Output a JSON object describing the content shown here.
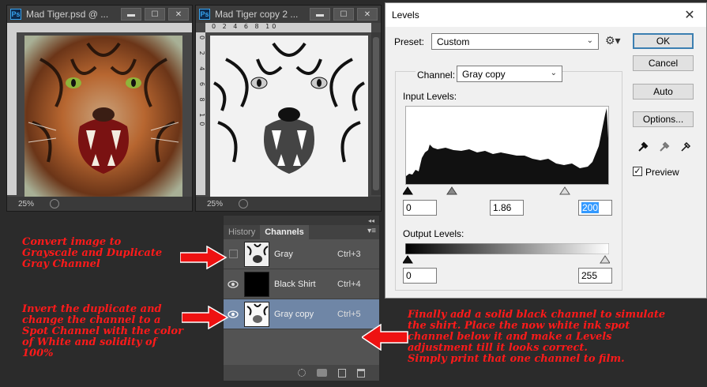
{
  "doc1": {
    "app_badge": "Ps",
    "title": "Mad Tiger.psd @ ...",
    "status_zoom": "25%"
  },
  "doc2": {
    "app_badge": "Ps",
    "title": "Mad Tiger copy 2 ...",
    "status_zoom": "25%",
    "ruler_h": "0   2   4   6   8   10",
    "ruler_v": "0 2 4 6 8 10"
  },
  "window_controls": {
    "minimize": "▬",
    "maximize": "☐",
    "close": "✕"
  },
  "levels": {
    "title": "Levels",
    "close": "✕",
    "preset_label": "Preset:",
    "preset_value": "Custom",
    "ok": "OK",
    "cancel": "Cancel",
    "auto": "Auto",
    "options": "Options...",
    "channel_label": "Channel:",
    "channel_value": "Gray copy",
    "input_levels_label": "Input Levels:",
    "input_black": "0",
    "input_gamma": "1.86",
    "input_white": "200",
    "output_levels_label": "Output Levels:",
    "output_black": "0",
    "output_white": "255",
    "preview_label": "Preview",
    "preview_checked": true
  },
  "channels_panel": {
    "tab_history": "History",
    "tab_channels": "Channels",
    "collapse": "◂◂",
    "menu": "▾≡",
    "rows": [
      {
        "name": "Gray",
        "shortcut": "Ctrl+3",
        "visible": false
      },
      {
        "name": "Black Shirt",
        "shortcut": "Ctrl+4",
        "visible": true
      },
      {
        "name": "Gray copy",
        "shortcut": "Ctrl+5",
        "visible": true,
        "selected": true
      }
    ]
  },
  "annotations": {
    "note1": "Convert image to\nGrayscale and Duplicate\nGray Channel",
    "note2": "Invert the duplicate and\nchange the channel to a\nSpot Channel with the color\nof White and solidity of\n100%",
    "note3": "Finally add a solid black channel to simulate\nthe shirt.  Place the now white ink spot\nchannel below it and make a Levels\nadjustment till it looks correct.\nSimply print that one channel to film."
  },
  "colors": {
    "annotation": "#ff1a1a",
    "arrow": "#ee1111",
    "selected_row": "#6f86a6"
  }
}
